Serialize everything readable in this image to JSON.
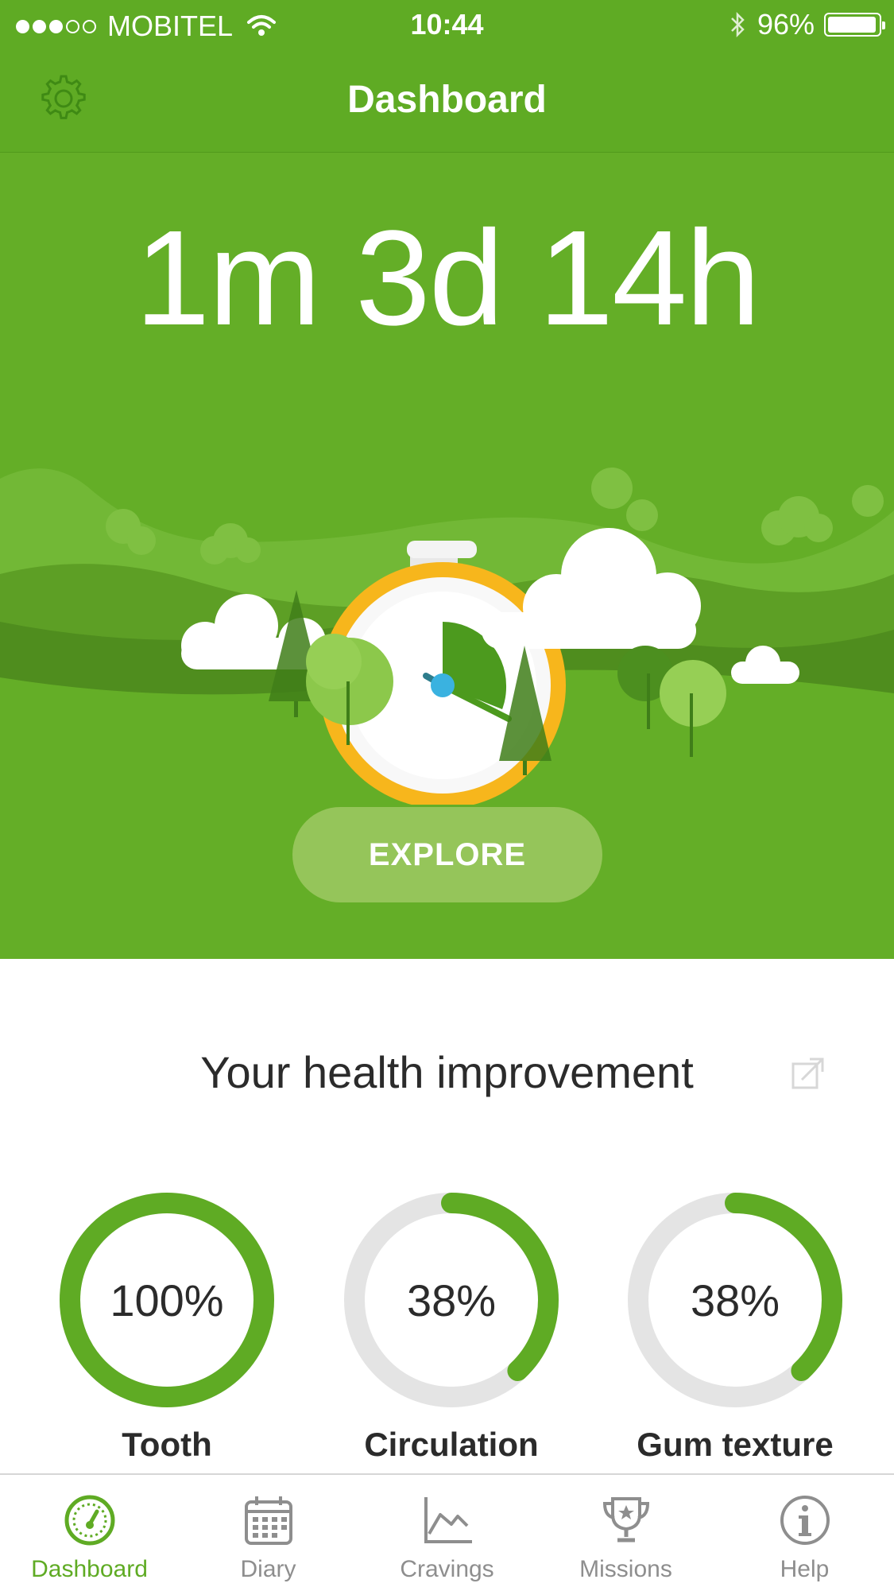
{
  "status_bar": {
    "carrier": "MOBITEL",
    "time": "10:44",
    "battery_text": "96%",
    "battery_level": 0.96,
    "signal_bars_filled": 3,
    "signal_bars_total": 5,
    "icons": [
      "wifi-icon",
      "bluetooth-icon",
      "battery-icon"
    ]
  },
  "nav": {
    "title": "Dashboard",
    "settings_icon": "gear-icon"
  },
  "hero": {
    "timer": "1m 3d 14h",
    "explore_label": "EXPLORE",
    "illustration": "stopwatch-landscape-illustration"
  },
  "health": {
    "title": "Your health improvement",
    "share_icon": "share-icon",
    "items": [
      {
        "label": "Tooth",
        "value_text": "100%",
        "value": 100
      },
      {
        "label": "Circulation",
        "value_text": "38%",
        "value": 38
      },
      {
        "label": "Gum texture",
        "value_text": "38%",
        "value": 38
      }
    ]
  },
  "tabs": [
    {
      "label": "Dashboard",
      "icon": "speedometer-icon",
      "active": true
    },
    {
      "label": "Diary",
      "icon": "calendar-icon",
      "active": false
    },
    {
      "label": "Cravings",
      "icon": "chart-icon",
      "active": false
    },
    {
      "label": "Missions",
      "icon": "trophy-icon",
      "active": false
    },
    {
      "label": "Help",
      "icon": "info-icon",
      "active": false
    }
  ],
  "colors": {
    "brand_green": "#5fab24",
    "ring_track": "#e4e4e4",
    "explore_button": "#95c55a",
    "inactive_tab": "#8e8e8e",
    "stopwatch_ring": "#f7b61c",
    "hand_blue": "#3ab2e0"
  }
}
